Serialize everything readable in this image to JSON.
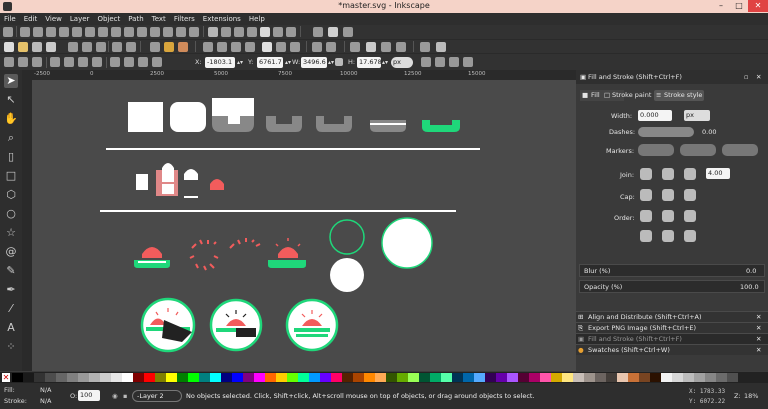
{
  "window": {
    "title": "*master.svg - Inkscape",
    "minimize": "–",
    "maximize": "□",
    "close": "✕",
    "close_color": "#e04343"
  },
  "menu": [
    "File",
    "Edit",
    "View",
    "Layer",
    "Object",
    "Path",
    "Text",
    "Filters",
    "Extensions",
    "Help"
  ],
  "toolbar": {
    "x_label": "X:",
    "x_value": "-1803.1",
    "y_label": "Y:",
    "y_value": "6761.7",
    "w_label": "W:",
    "w_value": "3496.6",
    "h_label": "H:",
    "h_value": "17.678",
    "unit": "px"
  },
  "ruler": {
    "ticks": [
      "-2500",
      "0",
      "2500",
      "5000",
      "7500",
      "10000",
      "12500",
      "15000"
    ]
  },
  "dock": {
    "panel_title": "Fill and Stroke (Shift+Ctrl+F)",
    "tabs": [
      "Fill",
      "Stroke paint",
      "Stroke style"
    ],
    "width_label": "Width:",
    "width_value": "0.000",
    "width_unit": "px",
    "dashes_label": "Dashes:",
    "dashes_value": "0.00",
    "markers_label": "Markers:",
    "join_label": "Join:",
    "join_value": "4.00",
    "cap_label": "Cap:",
    "order_label": "Order:",
    "blur_label": "Blur (%)",
    "blur_value": "0.0",
    "opacity_label": "Opacity (%)",
    "opacity_value": "100.0",
    "collapsed_panels": [
      "Align and Distribute (Shift+Ctrl+A)",
      "Export PNG Image (Shift+Ctrl+E)",
      "Fill and Stroke (Shift+Ctrl+F)",
      "Swatches (Shift+Ctrl+W)"
    ]
  },
  "status": {
    "fill_label": "Fill:",
    "fill_value": "N/A",
    "stroke_label": "Stroke:",
    "stroke_value": "N/A",
    "opacity_label": "O:",
    "opacity_value": "100",
    "layer": "-Layer 2",
    "message": "No objects selected. Click, Shift+click, Alt+scroll mouse on top of objects, or drag around objects to select.",
    "x_readout": "X: 1783.33",
    "y_readout": "Y: 6072.22",
    "zoom_label": "Z:",
    "zoom_value": "18%"
  },
  "colors": {
    "accent_green": "#1fd77a",
    "accent_red": "#f25c5c",
    "canvas": "#4a4a4a"
  },
  "palette": [
    "#000000",
    "#1a1a1a",
    "#333333",
    "#4d4d4d",
    "#666666",
    "#808080",
    "#999999",
    "#b3b3b3",
    "#cccccc",
    "#e6e6e6",
    "#ffffff",
    "#800000",
    "#ff0000",
    "#808000",
    "#ffff00",
    "#008000",
    "#00ff00",
    "#008080",
    "#00ffff",
    "#000080",
    "#0000ff",
    "#800080",
    "#ff00ff",
    "#ff6600",
    "#ffcc00",
    "#66ff00",
    "#00ff99",
    "#0099ff",
    "#6600ff",
    "#ff0066",
    "#552200",
    "#aa4400",
    "#ff8800",
    "#ffaa55",
    "#335500",
    "#66aa00",
    "#99ff55",
    "#005533",
    "#00aa66",
    "#55ffaa",
    "#003355",
    "#0066aa",
    "#55aaff",
    "#330055",
    "#6600aa",
    "#aa55ff",
    "#550033",
    "#aa0066",
    "#ff55aa",
    "#d4aa00",
    "#ffe680",
    "#c8beb7",
    "#9d938c",
    "#6c6460",
    "#443e3a",
    "#e9c6af",
    "#c87137",
    "#784421",
    "#2b1100",
    "#f2f2f2",
    "#d7d7d7",
    "#bcbcbc",
    "#a1a1a1",
    "#868686",
    "#6b6b6b",
    "#505050"
  ]
}
